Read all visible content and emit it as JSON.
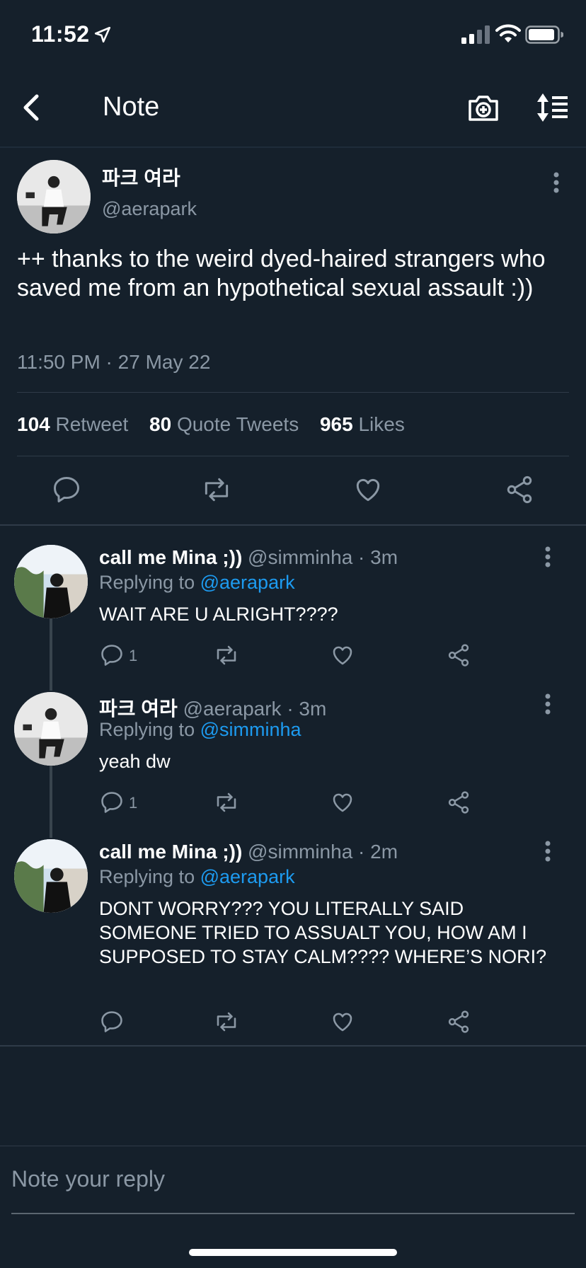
{
  "status_bar": {
    "time": "11:52"
  },
  "header": {
    "title": "Note"
  },
  "main_tweet": {
    "name": "파크 여라",
    "handle": "@aerapark",
    "text": "++ thanks to the weird dyed-haired strangers who saved me from an hypothetical sexual assault :))",
    "timestamp": "11:50 PM · 27 May 22",
    "stats": {
      "retweets": "104",
      "retweets_label": "Retweet",
      "quotes": "80",
      "quotes_label": "Quote Tweets",
      "likes": "965",
      "likes_label": "Likes"
    }
  },
  "replies": [
    {
      "name": "call me Mina ;))",
      "meta": "@simminha · 3m",
      "replying_prefix": "Replying to",
      "replying_to": "@aerapark",
      "text": "WAIT ARE U ALRIGHT????",
      "reply_count": "1"
    },
    {
      "name": "파크 여라",
      "meta": "@aerapark · 3m",
      "replying_prefix": "Replying to",
      "replying_to": "@simminha",
      "text": "yeah dw",
      "reply_count": "1"
    },
    {
      "name": "call me Mina ;))",
      "meta": "@simminha · 2m",
      "replying_prefix": "Replying to",
      "replying_to": "@aerapark",
      "text": "DONT WORRY??? YOU LITERALLY SAID SOMEONE TRIED TO ASSUALT YOU, HOW AM I SUPPOSED TO STAY CALM???? WHERE’S NORI?",
      "reply_count": ""
    }
  ],
  "reply_box": {
    "placeholder": "Note your reply"
  },
  "colors": {
    "background": "#15202b",
    "accent": "#1d9bf0",
    "muted": "#8b98a5"
  }
}
